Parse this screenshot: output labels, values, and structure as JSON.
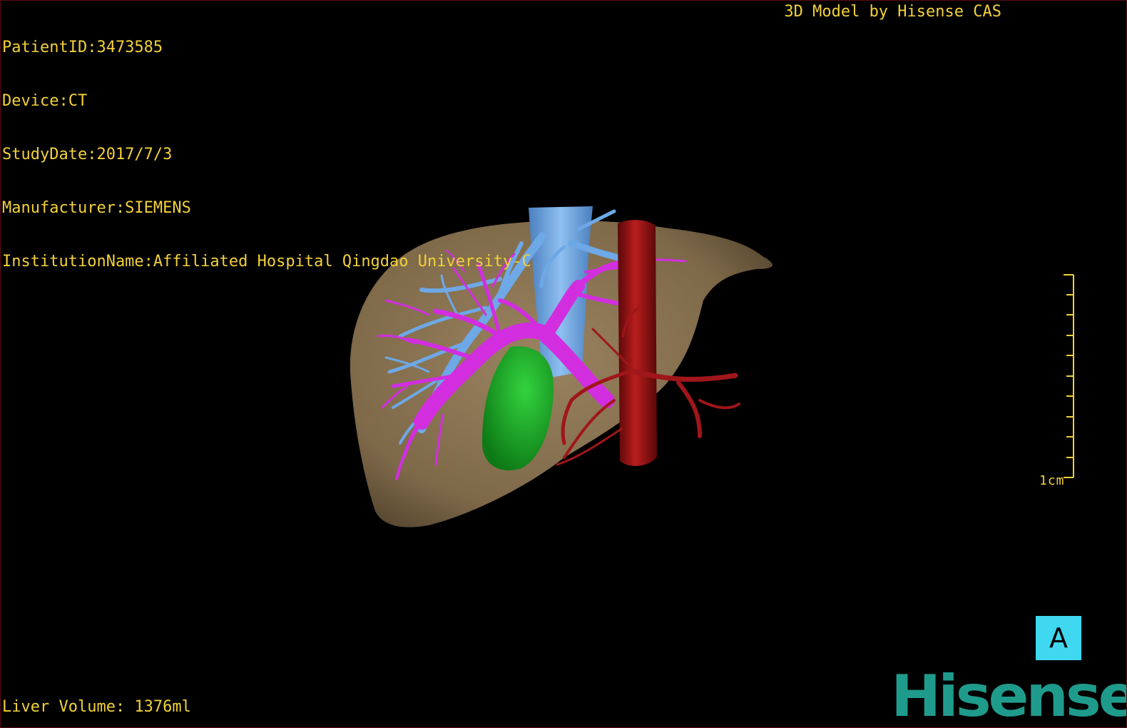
{
  "patient_info": {
    "patient_id": "PatientID:3473585",
    "device": "Device:CT",
    "study_date": "StudyDate:2017/7/3",
    "manufacturer": "Manufacturer:SIEMENS",
    "institution": "InstitutionName:Affiliated Hospital Qingdao University-C"
  },
  "credit": "3D Model by Hisense CAS",
  "liver_volume": "Liver Volume: 1376ml",
  "scale_bar": {
    "label": "1cm",
    "tick_count": 11
  },
  "view_button": {
    "label": "A"
  },
  "brand": {
    "name": "Hisense",
    "color": "#1f9b8c"
  },
  "colors": {
    "overlay_text": "#f2d13a",
    "liver": "#8b7555",
    "hepatic_vein": "#6ea8e6",
    "portal_vein": "#d22ee0",
    "gallbladder": "#1fae2a",
    "aorta": "#9c1414",
    "view_button": "#3fd8f0"
  }
}
